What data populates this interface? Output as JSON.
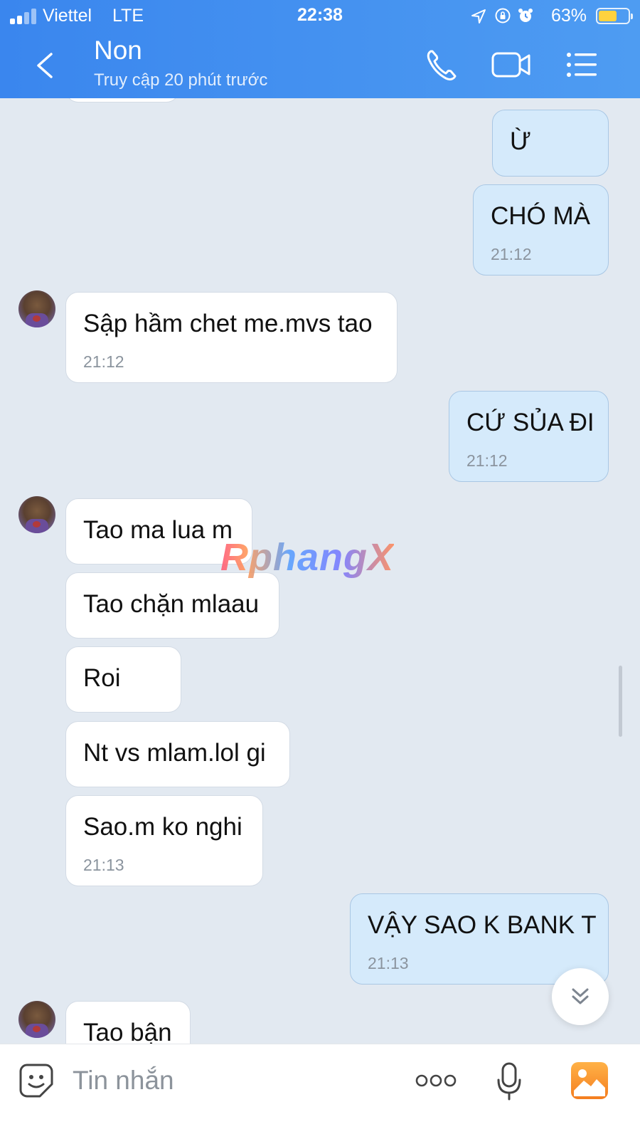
{
  "status_bar": {
    "carrier": "Viettel",
    "network": "LTE",
    "time": "22:38",
    "battery_percent": "63%",
    "battery_level": 0.63
  },
  "header": {
    "contact_name": "Non",
    "last_seen": "Truy cập 20 phút trước",
    "icons": [
      "back-icon",
      "phone-icon",
      "video-icon",
      "menu-icon"
    ]
  },
  "messages": [
    {
      "direction": "out",
      "text": "Ừ",
      "time": ""
    },
    {
      "direction": "out",
      "text": "CHÓ MÀ",
      "time": "21:12"
    },
    {
      "direction": "in",
      "text": "Sập hầm chet me.mvs tao",
      "time": "21:12"
    },
    {
      "direction": "out",
      "text": "CỨ SỦA ĐI",
      "time": "21:12"
    },
    {
      "direction": "in",
      "text": "Tao ma lua m",
      "time": ""
    },
    {
      "direction": "in",
      "text": "Tao chặn mlaau",
      "time": ""
    },
    {
      "direction": "in",
      "text": "Roi",
      "time": ""
    },
    {
      "direction": "in",
      "text": "Nt vs mlam.lol gi",
      "time": ""
    },
    {
      "direction": "in",
      "text": "Sao.m ko nghi",
      "time": "21:13"
    },
    {
      "direction": "out",
      "text": "VẬY SAO K BANK T",
      "time": "21:13"
    },
    {
      "direction": "in",
      "text": "Tao bận",
      "time": ""
    }
  ],
  "watermark": "RphangX",
  "input": {
    "placeholder": "Tin nhắn"
  },
  "colors": {
    "header": "#4a92f0",
    "chat_background": "#e2e9f1",
    "outgoing_bubble": "#d5eafb",
    "incoming_bubble": "#ffffff",
    "image_button": "#f58c2a"
  }
}
